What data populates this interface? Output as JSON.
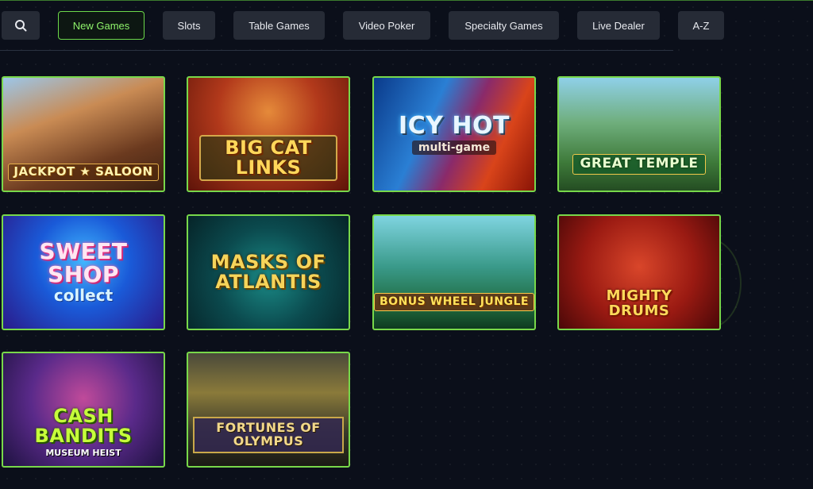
{
  "nav": {
    "search_icon": "search-icon",
    "tabs": [
      {
        "label": "New Games",
        "active": true
      },
      {
        "label": "Slots",
        "active": false
      },
      {
        "label": "Table Games",
        "active": false
      },
      {
        "label": "Video Poker",
        "active": false
      },
      {
        "label": "Specialty Games",
        "active": false
      },
      {
        "label": "Live Dealer",
        "active": false
      },
      {
        "label": "A-Z",
        "active": false
      }
    ]
  },
  "games": [
    {
      "title": "JACKPOT ★ SALOON"
    },
    {
      "title": "BIG CAT LINKS"
    },
    {
      "title": "ICY HOT",
      "subtitle": "multi-game"
    },
    {
      "title": "GREAT TEMPLE"
    },
    {
      "title": "SWEET SHOP",
      "subtitle": "collect"
    },
    {
      "title": "MASKS OF ATLANTIS"
    },
    {
      "title": "BONUS WHEEL JUNGLE"
    },
    {
      "title": "MIGHTY DRUMS"
    },
    {
      "title": "CASH BANDITS",
      "subtitle": "MUSEUM HEIST"
    },
    {
      "title": "FORTUNES OF OLYMPUS"
    }
  ],
  "colors": {
    "accent": "#78d84a",
    "background": "#0b0f1a",
    "tab_bg": "#262b36"
  }
}
